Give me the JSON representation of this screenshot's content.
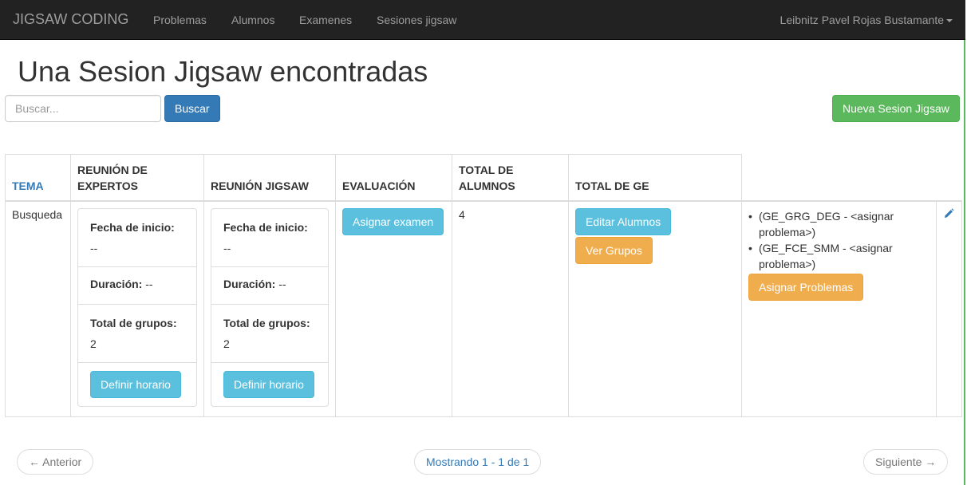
{
  "navbar": {
    "brand": "JIGSAW CODING",
    "links": [
      "Problemas",
      "Alumnos",
      "Examenes",
      "Sesiones jigsaw"
    ],
    "user": "Leibnitz Pavel Rojas Bustamante"
  },
  "page": {
    "title": "Una Sesion Jigsaw encontradas",
    "search_placeholder": "Buscar...",
    "search_button": "Buscar",
    "new_button": "Nueva Sesion Jigsaw"
  },
  "table": {
    "headers": {
      "tema": "TEMA",
      "expertos": "REUNIÓN DE EXPERTOS",
      "jigsaw": "REUNIÓN JIGSAW",
      "evaluacion": "EVALUACIÓN",
      "total_alumnos": "TOTAL DE ALUMNOS",
      "total_ge": "TOTAL DE GE"
    },
    "row": {
      "tema": "Busqueda",
      "expertos": {
        "fecha_label": "Fecha de inicio:",
        "fecha_value": "--",
        "duracion_label": "Duración:",
        "duracion_value": "--",
        "grupos_label": "Total de grupos:",
        "grupos_value": "2",
        "button": "Definir horario"
      },
      "jigsaw": {
        "fecha_label": "Fecha de inicio:",
        "fecha_value": "--",
        "duracion_label": "Duración:",
        "duracion_value": "--",
        "grupos_label": "Total de grupos:",
        "grupos_value": "2",
        "button": "Definir horario"
      },
      "evaluacion_button": "Asignar examen",
      "total_alumnos": "4",
      "editar_alumnos": "Editar Alumnos",
      "ver_grupos": "Ver Grupos",
      "ge_items": [
        "(GE_GRG_DEG - <asignar problema>)",
        "(GE_FCE_SMM - <asignar problema>)"
      ],
      "asignar_problemas": "Asignar Problemas",
      "edit_icon": "pencil-icon"
    }
  },
  "pager": {
    "prev": "← Anterior",
    "info": "Mostrando 1 - 1 de 1",
    "next": "Siguiente →"
  },
  "colors": {
    "navbar": "#222222",
    "primary": "#337ab7",
    "success": "#5cb85c",
    "info": "#5bc0de",
    "warning": "#f0ad4e"
  }
}
